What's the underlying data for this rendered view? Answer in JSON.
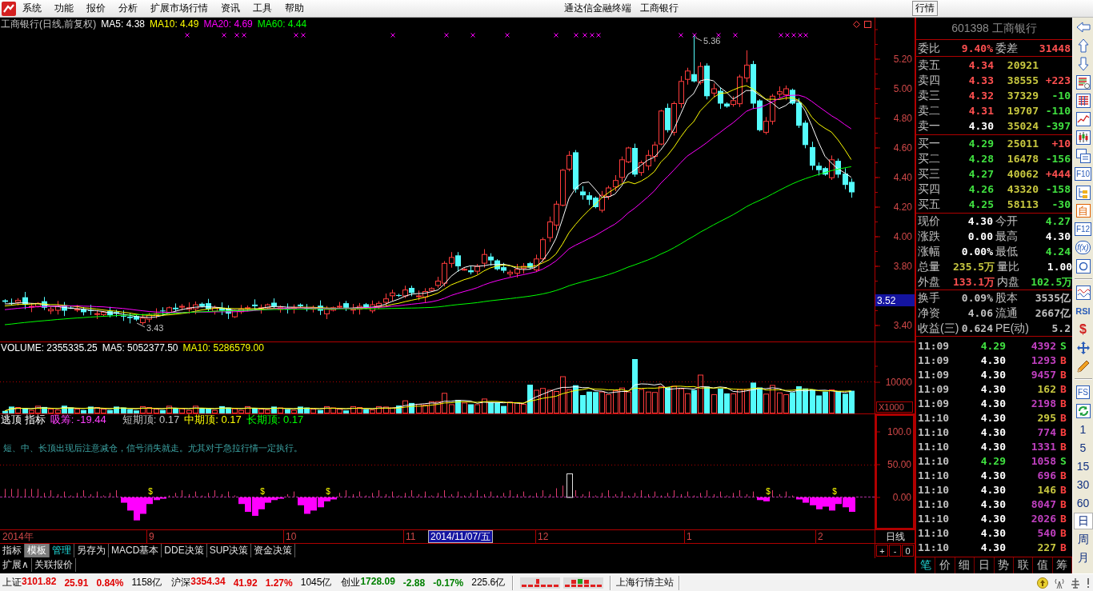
{
  "menubar": {
    "items": [
      "系统",
      "功能",
      "报价",
      "分析",
      "扩展市场行情",
      "资讯",
      "工具",
      "帮助"
    ],
    "title": [
      "通达信金融终端",
      "工商银行"
    ],
    "tab": "行情"
  },
  "price_chart": {
    "legend": [
      {
        "text": "工商银行(日线,前复权)",
        "color": "#c0c0c0"
      },
      {
        "text": "MA5: 4.38",
        "color": "#ffffff"
      },
      {
        "text": "MA10: 4.49",
        "color": "#ffff00"
      },
      {
        "text": "MA20: 4.69",
        "color": "#ff00ff"
      },
      {
        "text": "MA60: 4.44",
        "color": "#00ff00"
      }
    ],
    "y_labels": [
      "5.20",
      "5.00",
      "4.80",
      "4.60",
      "4.40",
      "4.20",
      "4.00",
      "3.80",
      "3.40"
    ],
    "cursor_price": "3.52",
    "high_label": "5.36",
    "low_label": "3.43"
  },
  "volume_chart": {
    "legend": [
      {
        "text": "VOLUME: 2355335.25",
        "color": "#ffffff"
      },
      {
        "text": "MA5: 5052377.50",
        "color": "#ffffff"
      },
      {
        "text": "MA10: 5286579.00",
        "color": "#ffff00"
      }
    ],
    "y_labels": [
      "10000"
    ],
    "unit": "X1000"
  },
  "indicator": {
    "legend": [
      {
        "text": "逃顶 指标",
        "color": "#ffffff"
      },
      {
        "text": "吸筹: -19.44",
        "color": "#ff40ff"
      },
      {
        "text": "短期顶: 0.17",
        "color": "#c0c0c0"
      },
      {
        "text": "中期顶: 0.17",
        "color": "#ffff00"
      },
      {
        "text": "长期顶: 0.17",
        "color": "#00ff00"
      }
    ],
    "note": "短、中、长顶出现后注意减仓，信号消失就走。尤其对于急拉行情一定执行。",
    "y_labels": [
      "100.0",
      "50.00",
      "0.00"
    ],
    "signal_marks": [
      "$",
      "$",
      "$",
      "$",
      "$"
    ]
  },
  "date_axis": {
    "labels": [
      "2014年",
      "9",
      "10",
      "11",
      "12",
      "1",
      "2"
    ],
    "cursor_date": "2014/11/07/五",
    "period": "日线"
  },
  "chart_tabs": [
    {
      "label": "指标",
      "selected": false,
      "highlighted": false
    },
    {
      "label": "模板",
      "selected": true,
      "highlighted": false
    },
    {
      "label": "管理",
      "selected": false,
      "highlighted": true
    },
    {
      "label": "另存为",
      "selected": false,
      "highlighted": false
    },
    {
      "label": "MACD基本",
      "selected": false,
      "highlighted": false
    },
    {
      "label": "DDE决策",
      "selected": false,
      "highlighted": false
    },
    {
      "label": "SUP决策",
      "selected": false,
      "highlighted": false
    },
    {
      "label": "资金决策",
      "selected": false,
      "highlighted": false
    }
  ],
  "zoom_buttons": [
    "+",
    "-",
    "0"
  ],
  "extra_tabs": [
    "扩展∧",
    "关联报价"
  ],
  "quote": {
    "title": "601398 工商银行",
    "ratio": {
      "label": "委比",
      "value": {
        "text": "9.40%",
        "color": "#ff5050"
      },
      "label2": "委差",
      "value2": {
        "text": "31448",
        "color": "#ff5050"
      }
    },
    "asks": [
      {
        "label": "卖五",
        "price": {
          "text": "4.34",
          "color": "#ff5050"
        },
        "volume": "20921"
      },
      {
        "label": "卖四",
        "price": {
          "text": "4.33",
          "color": "#ff5050"
        },
        "volume": "38555",
        "change": {
          "text": "+223",
          "color": "#ff5050"
        }
      },
      {
        "label": "卖三",
        "price": {
          "text": "4.32",
          "color": "#ff5050"
        },
        "volume": "37329",
        "change": {
          "text": "-10",
          "color": "#40e040"
        }
      },
      {
        "label": "卖二",
        "price": {
          "text": "4.31",
          "color": "#ff5050"
        },
        "volume": "19707",
        "change": {
          "text": "-110",
          "color": "#40e040"
        }
      },
      {
        "label": "卖一",
        "price": {
          "text": "4.30",
          "color": "#ffffff"
        },
        "volume": "35024",
        "change": {
          "text": "-397",
          "color": "#40e040"
        }
      }
    ],
    "bids": [
      {
        "label": "买一",
        "price": {
          "text": "4.29",
          "color": "#40e040"
        },
        "volume": "25011",
        "change": {
          "text": "+10",
          "color": "#ff5050"
        }
      },
      {
        "label": "买二",
        "price": {
          "text": "4.28",
          "color": "#40e040"
        },
        "volume": "16478",
        "change": {
          "text": "-156",
          "color": "#40e040"
        }
      },
      {
        "label": "买三",
        "price": {
          "text": "4.27",
          "color": "#40e040"
        },
        "volume": "40062",
        "change": {
          "text": "+444",
          "color": "#ff5050"
        }
      },
      {
        "label": "买四",
        "price": {
          "text": "4.26",
          "color": "#40e040"
        },
        "volume": "43320",
        "change": {
          "text": "-158",
          "color": "#40e040"
        }
      },
      {
        "label": "买五",
        "price": {
          "text": "4.25",
          "color": "#40e040"
        },
        "volume": "58113",
        "change": {
          "text": "-30",
          "color": "#40e040"
        }
      }
    ],
    "stats": [
      {
        "label": "现价",
        "value": {
          "text": "4.30",
          "color": "#ffffff"
        },
        "label2": "今开",
        "value2": {
          "text": "4.27",
          "color": "#40e040"
        }
      },
      {
        "label": "涨跌",
        "value": {
          "text": "0.00",
          "color": "#ffffff"
        },
        "label2": "最高",
        "value2": {
          "text": "4.30",
          "color": "#ffffff"
        }
      },
      {
        "label": "涨幅",
        "value": {
          "text": "0.00%",
          "color": "#ffffff"
        },
        "label2": "最低",
        "value2": {
          "text": "4.24",
          "color": "#40e040"
        }
      },
      {
        "label": "总量",
        "value": {
          "text": "235.5万",
          "color": "#c8c840"
        },
        "label2": "量比",
        "value2": {
          "text": "1.00",
          "color": "#ffffff"
        }
      },
      {
        "label": "外盘",
        "value": {
          "text": "133.1万",
          "color": "#ff5050"
        },
        "label2": "内盘",
        "value2": {
          "text": "102.5万",
          "color": "#40e040"
        }
      }
    ],
    "info": [
      {
        "label": "换手",
        "value": "0.09%",
        "label2": "股本",
        "value2": "3535亿"
      },
      {
        "label": "净资",
        "value": "4.06",
        "label2": "流通",
        "value2": "2667亿"
      },
      {
        "label": "收益(三)",
        "value": "0.624",
        "label2": "PE(动)",
        "value2": "5.2"
      }
    ],
    "ticks": [
      {
        "time": "11:09",
        "price": {
          "text": "4.29",
          "color": "#40e040"
        },
        "volume": {
          "text": "4392",
          "color": "#c040c0"
        },
        "side": {
          "text": "S",
          "color": "#40e040"
        }
      },
      {
        "time": "11:09",
        "price": {
          "text": "4.30",
          "color": "#ffffff"
        },
        "volume": {
          "text": "1293",
          "color": "#c040c0"
        },
        "side": {
          "text": "B",
          "color": "#ff4040"
        }
      },
      {
        "time": "11:09",
        "price": {
          "text": "4.30",
          "color": "#ffffff"
        },
        "volume": {
          "text": "9457",
          "color": "#c040c0"
        },
        "side": {
          "text": "B",
          "color": "#ff4040"
        }
      },
      {
        "time": "11:09",
        "price": {
          "text": "4.30",
          "color": "#ffffff"
        },
        "volume": {
          "text": "162",
          "color": "#c8c840"
        },
        "side": {
          "text": "B",
          "color": "#ff4040"
        }
      },
      {
        "time": "11:09",
        "price": {
          "text": "4.30",
          "color": "#ffffff"
        },
        "volume": {
          "text": "2198",
          "color": "#c040c0"
        },
        "side": {
          "text": "B",
          "color": "#ff4040"
        }
      },
      {
        "time": "11:10",
        "price": {
          "text": "4.30",
          "color": "#ffffff"
        },
        "volume": {
          "text": "295",
          "color": "#c8c840"
        },
        "side": {
          "text": "B",
          "color": "#ff4040"
        }
      },
      {
        "time": "11:10",
        "price": {
          "text": "4.30",
          "color": "#ffffff"
        },
        "volume": {
          "text": "774",
          "color": "#c040c0"
        },
        "side": {
          "text": "B",
          "color": "#ff4040"
        }
      },
      {
        "time": "11:10",
        "price": {
          "text": "4.30",
          "color": "#ffffff"
        },
        "volume": {
          "text": "1331",
          "color": "#c040c0"
        },
        "side": {
          "text": "B",
          "color": "#ff4040"
        }
      },
      {
        "time": "11:10",
        "price": {
          "text": "4.29",
          "color": "#40e040"
        },
        "volume": {
          "text": "1058",
          "color": "#c040c0"
        },
        "side": {
          "text": "S",
          "color": "#40e040"
        }
      },
      {
        "time": "11:10",
        "price": {
          "text": "4.30",
          "color": "#ffffff"
        },
        "volume": {
          "text": "696",
          "color": "#c040c0"
        },
        "side": {
          "text": "B",
          "color": "#ff4040"
        }
      },
      {
        "time": "11:10",
        "price": {
          "text": "4.30",
          "color": "#ffffff"
        },
        "volume": {
          "text": "146",
          "color": "#c8c840"
        },
        "side": {
          "text": "B",
          "color": "#ff4040"
        }
      },
      {
        "time": "11:10",
        "price": {
          "text": "4.30",
          "color": "#ffffff"
        },
        "volume": {
          "text": "8047",
          "color": "#c040c0"
        },
        "side": {
          "text": "B",
          "color": "#ff4040"
        }
      },
      {
        "time": "11:10",
        "price": {
          "text": "4.30",
          "color": "#ffffff"
        },
        "volume": {
          "text": "2026",
          "color": "#c040c0"
        },
        "side": {
          "text": "B",
          "color": "#ff4040"
        }
      },
      {
        "time": "11:10",
        "price": {
          "text": "4.30",
          "color": "#ffffff"
        },
        "volume": {
          "text": "540",
          "color": "#c040c0"
        },
        "side": {
          "text": "B",
          "color": "#ff4040"
        }
      },
      {
        "time": "11:10",
        "price": {
          "text": "4.30",
          "color": "#ffffff"
        },
        "volume": {
          "text": "227",
          "color": "#c8c840"
        },
        "side": {
          "text": "B",
          "color": "#ff4040"
        }
      }
    ],
    "tabs": [
      {
        "label": "笔",
        "selected": true
      },
      {
        "label": "价",
        "selected": false
      },
      {
        "label": "细",
        "selected": false
      },
      {
        "label": "日",
        "selected": false
      },
      {
        "label": "势",
        "selected": false
      },
      {
        "label": "联",
        "selected": false
      },
      {
        "label": "值",
        "selected": false
      },
      {
        "label": "筹",
        "selected": false
      }
    ]
  },
  "toolbar": {
    "tools": [
      {
        "kind": "icon"
      },
      {
        "kind": "icon"
      },
      {
        "kind": "icon"
      },
      {
        "kind": "icon"
      },
      {
        "kind": "icon"
      },
      {
        "kind": "icon"
      },
      {
        "kind": "icon"
      },
      {
        "kind": "icon"
      },
      {
        "kind": "text",
        "label": "F10"
      },
      {
        "kind": "icon"
      },
      {
        "kind": "text",
        "label": "自"
      },
      {
        "kind": "text",
        "label": "F12"
      },
      {
        "kind": "text",
        "label": "f(x)"
      },
      {
        "kind": "icon"
      },
      {
        "kind": "separator"
      },
      {
        "kind": "icon"
      },
      {
        "kind": "text",
        "label": "RSI"
      },
      {
        "kind": "text",
        "label": "$"
      },
      {
        "kind": "icon"
      },
      {
        "kind": "icon"
      },
      {
        "kind": "separator"
      },
      {
        "kind": "text",
        "label": "FS"
      },
      {
        "kind": "icon"
      }
    ],
    "periods": [
      {
        "label": "1",
        "selected": false
      },
      {
        "label": "5",
        "selected": false
      },
      {
        "label": "15",
        "selected": false
      },
      {
        "label": "30",
        "selected": false
      },
      {
        "label": "60",
        "selected": false
      },
      {
        "label": "日",
        "selected": true
      },
      {
        "label": "周",
        "selected": false
      },
      {
        "label": "月",
        "selected": false
      }
    ]
  },
  "status_bar": {
    "indices": [
      {
        "name": "上证",
        "value": "3101.82",
        "change": "25.91",
        "percent": "0.84%",
        "amount": "1158亿",
        "color": "#e00000"
      },
      {
        "name": "沪深",
        "value": "3354.34",
        "change": "41.92",
        "percent": "1.27%",
        "amount": "1045亿",
        "color": "#e00000"
      },
      {
        "name": "创业",
        "value": "1728.09",
        "change": "-2.88",
        "percent": "-0.17%",
        "amount": "225.6亿",
        "color": "#008000"
      }
    ],
    "server": "上海行情主站"
  }
}
